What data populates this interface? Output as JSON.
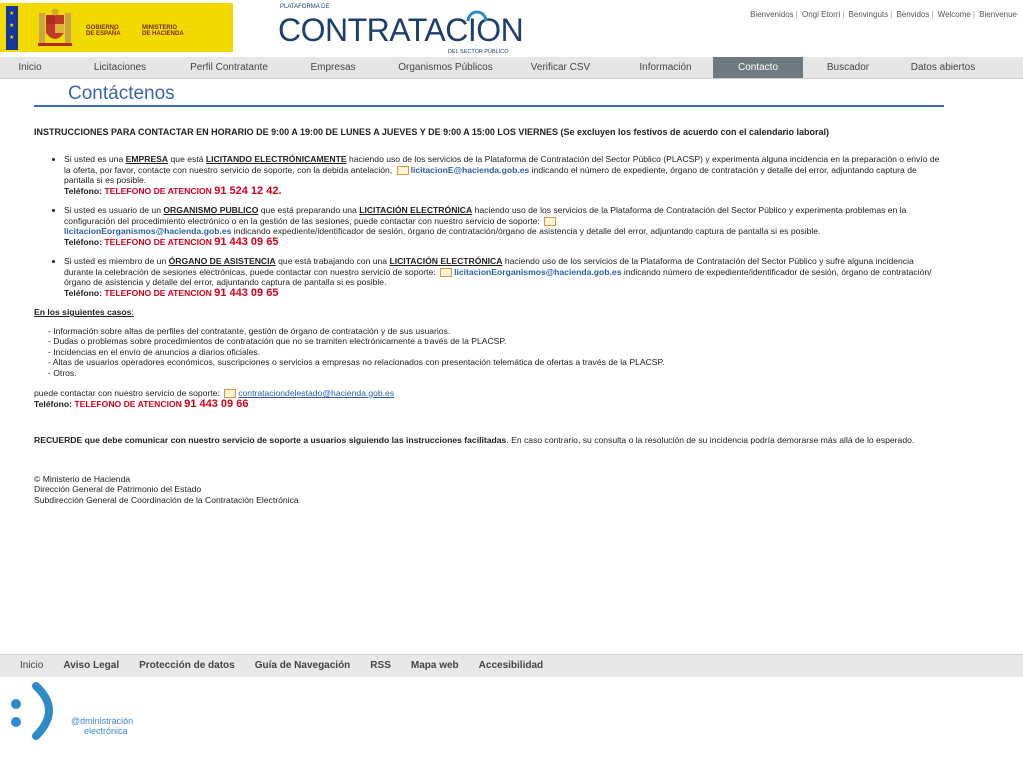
{
  "header": {
    "gov_line1": "GOBIERNO",
    "gov_line2": "DE ESPAÑA",
    "min_line1": "MINISTERIO",
    "min_line2": "DE HACIENDA",
    "brand_pre": "PLATAFORMA DE",
    "brand_main_a": "CONTRATAC",
    "brand_main_b": "I",
    "brand_main_c": "ON",
    "brand_post": "DEL SECTOR PÚBLICO",
    "languages": [
      "Bienvenidos",
      "Ongi Etorri",
      "Benvinguts",
      "Benvidos",
      "Welcome",
      "Bienvenue"
    ]
  },
  "nav": {
    "items": [
      "Inicio",
      "Licitaciones",
      "Perfil Contratante",
      "Empresas",
      "Organismos Públicos",
      "Verificar CSV",
      "Información",
      "Contacto",
      "Buscador",
      "Datos abiertos"
    ],
    "active": "Contacto"
  },
  "page": {
    "title": "Contáctenos",
    "instructions": "INSTRUCCIONES PARA CONTACTAR EN HORARIO DE 9:00 A 19:00 DE LUNES A JUEVES Y DE 9:00 A 15:00 LOS VIERNES (Se excluyen los festivos de acuerdo con el calendario laboral)",
    "case1": {
      "pre": "Si usted es una ",
      "u1": "EMPRESA",
      "mid": " que está ",
      "u2": "LICITANDO ELECTRÓNICAMENTE",
      "post": " haciendo uso de los servicios de la Plataforma de Contratación del Sector Público (PLACSP) y experimenta alguna incidencia en la preparación o envío de la oferta, por favor, contacte con nuestro servicio de soporte, con la debida antelación, ",
      "email": "licitacionE@hacienda.gob.es",
      "post2": " indicando el número de expediente, órgano de contratación y detalle del error, adjuntando captura de pantalla si es posible.",
      "phone_label": "Teléfono: ",
      "phone_red": "TELEFONO DE ATENCION ",
      "phone_num": "91 524 12 42."
    },
    "case2": {
      "pre": "Si usted es usuario de un ",
      "u1": "ORGANISMO PUBLICO",
      "mid": " que está preparando una ",
      "u2": "LICITACIÓN ELECTRÓNICA",
      "post": " haciendo uso de los servicios de la Plataforma de Contratación del Sector Público y experimenta problemas en la configuración del procedimiento electrónico o en la gestión de las sesiones, puede contactar con nuestro servicio de soporte: ",
      "email": "licitacionEorganismos@hacienda.gob.es",
      "post2": " indicando expediente/identificador de sesión, órgano de contratación/órgano de asistencia y detalle del error, adjuntando captura de pantalla si es posible.",
      "phone_label": "Teléfono: ",
      "phone_red": "TELEFONO DE ATENCION ",
      "phone_num": "91 443 09 65"
    },
    "case3": {
      "pre": "Si usted es miembro de un ",
      "u1": "ÓRGANO DE ASISTENCIA",
      "mid": " que está trabajando con una ",
      "u2": "LICITACIÓN ELECTRÓNICA",
      "post": " haciendo uso de los servicios de la Plataforma de Contratación del Sector Público y sufre alguna incidencia durante la celebración de sesiones electrónicas, puede contactar con nuestro servicio de soporte: ",
      "email": "licitacionEorganismos@hacienda.gob.es",
      "post2": " indicando número de expediente/identificador de sesión, órgano de contratación/órgano de asistencia y detalle del error, adjuntando captura de pantalla si es posible.",
      "phone_label": "Teléfono: ",
      "phone_red": "TELEFONO DE ATENCION ",
      "phone_num": "91 443 09 65"
    },
    "other_heading": "En los siguientes casos",
    "other_colon": ":",
    "other_items": [
      "- Información sobre altas de perfiles del contratante, gestión de órgano de contratación y de sus usuarios.",
      "- Dudas o problemas sobre procedimientos de contratación que no se tramiten electrónicamente a través de la PLACSP.",
      "- Incidencias en el envío de anuncios a diarios oficiales.",
      "- Altas de usuarios operadores económicos, suscripciones o servicios a empresas no relacionados con presentación telemática de ofertas a través de la PLACSP.",
      "- Otros."
    ],
    "support_pre": "puede contactar con nuestro servicio de soporte: ",
    "support_email": "contrataciondelestado@hacienda.gob.es",
    "support_phone_label": "Teléfono: ",
    "support_phone_red": "TELEFONO DE ATENCION ",
    "support_phone_num": "91 443 09 66",
    "recuerde_bold": "RECUERDE que debe comunicar con nuestro servicio de soporte a usuarios siguiendo las instrucciones facilitadas",
    "recuerde_rest": ". En caso contrario, su consulta o la resolución de su incidencia podría demorarse más allá de lo esperado.",
    "footer_lines": [
      "© Ministerio de Hacienda",
      "Dirección General de Patrimonio del Estado",
      "Subdirección General de Coordinación de la Contratación Electrónica"
    ]
  },
  "footer_nav": [
    "Inicio",
    "Aviso Legal",
    "Protección de datos",
    "Guía de Navegación",
    "RSS",
    "Mapa web",
    "Accesibilidad"
  ],
  "ae_logo": {
    "line1": "@dministración",
    "line2": "electrónica"
  },
  "colors": {
    "nav_active": "#6e7a82",
    "title_blue": "#3a66a9",
    "phone_red": "#d6001c",
    "link_blue": "#2a5fa8",
    "gov_yellow": "#f2d900"
  }
}
